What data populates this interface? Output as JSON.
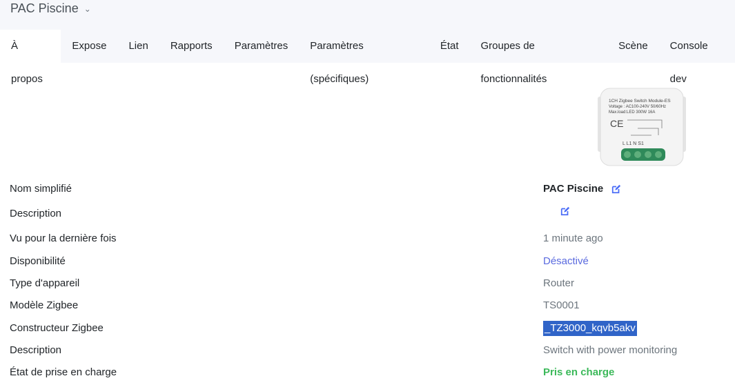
{
  "header": {
    "title": "PAC Piscine"
  },
  "tabs": [
    "À propos",
    "Expose",
    "Lien",
    "Rapports",
    "Paramètres",
    "Paramètres (spécifiques)",
    "État",
    "Groupes de fonctionnalités",
    "Scène",
    "Console dev"
  ],
  "device_image": {
    "lettering": [
      "1CH Zigbee Switch Module-ES",
      "Voltage : AC100-240V 50/60Hz",
      "Max.load:LED 300W 16A",
      "L L1 N S1"
    ]
  },
  "rows": [
    {
      "label": "Nom simplifié",
      "value": "PAC Piscine"
    },
    {
      "label": "Description",
      "value": ""
    },
    {
      "label": "Vu pour la dernière fois",
      "value": "1 minute ago"
    },
    {
      "label": "Disponibilité",
      "value": "Désactivé"
    },
    {
      "label": "Type d'appareil",
      "value": "Router"
    },
    {
      "label": "Modèle Zigbee",
      "value": "TS0001"
    },
    {
      "label": "Constructeur Zigbee",
      "value": "_TZ3000_kqvb5akv"
    },
    {
      "label": "Description",
      "value": "Switch with power monitoring"
    },
    {
      "label": "État de prise en charge",
      "value": "Pris en charge"
    }
  ],
  "colors": {
    "accent": "#4a6cf7",
    "link": "#5a6adf",
    "success": "#3cb95a",
    "selection": "#3064c8"
  }
}
